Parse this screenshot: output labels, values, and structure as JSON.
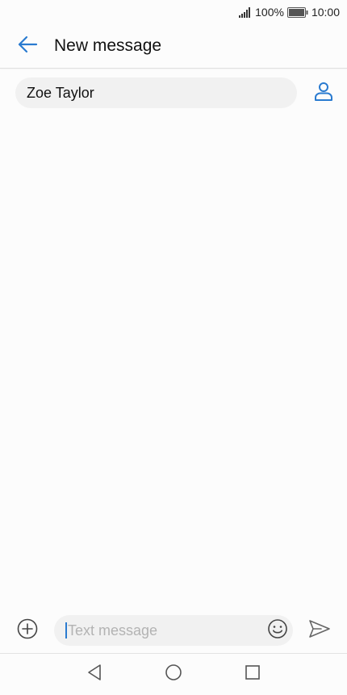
{
  "status_bar": {
    "battery_percent": "100%",
    "time": "10:00",
    "signal_icon": "signal-icon",
    "battery_icon": "battery-icon"
  },
  "header": {
    "title": "New message",
    "back_icon": "back-arrow-icon"
  },
  "recipient": {
    "name": "Zoe Taylor",
    "contact_icon": "contact-icon"
  },
  "composer": {
    "placeholder": "Text message",
    "value": "",
    "attach_icon": "add-circle-icon",
    "emoji_icon": "emoji-icon",
    "send_icon": "send-icon"
  },
  "navigation": {
    "back_icon": "nav-back-icon",
    "home_icon": "nav-home-icon",
    "recents_icon": "nav-recents-icon"
  },
  "colors": {
    "accent": "#2a7bd0",
    "background": "#fcfcfc",
    "field": "#f1f1f1"
  }
}
